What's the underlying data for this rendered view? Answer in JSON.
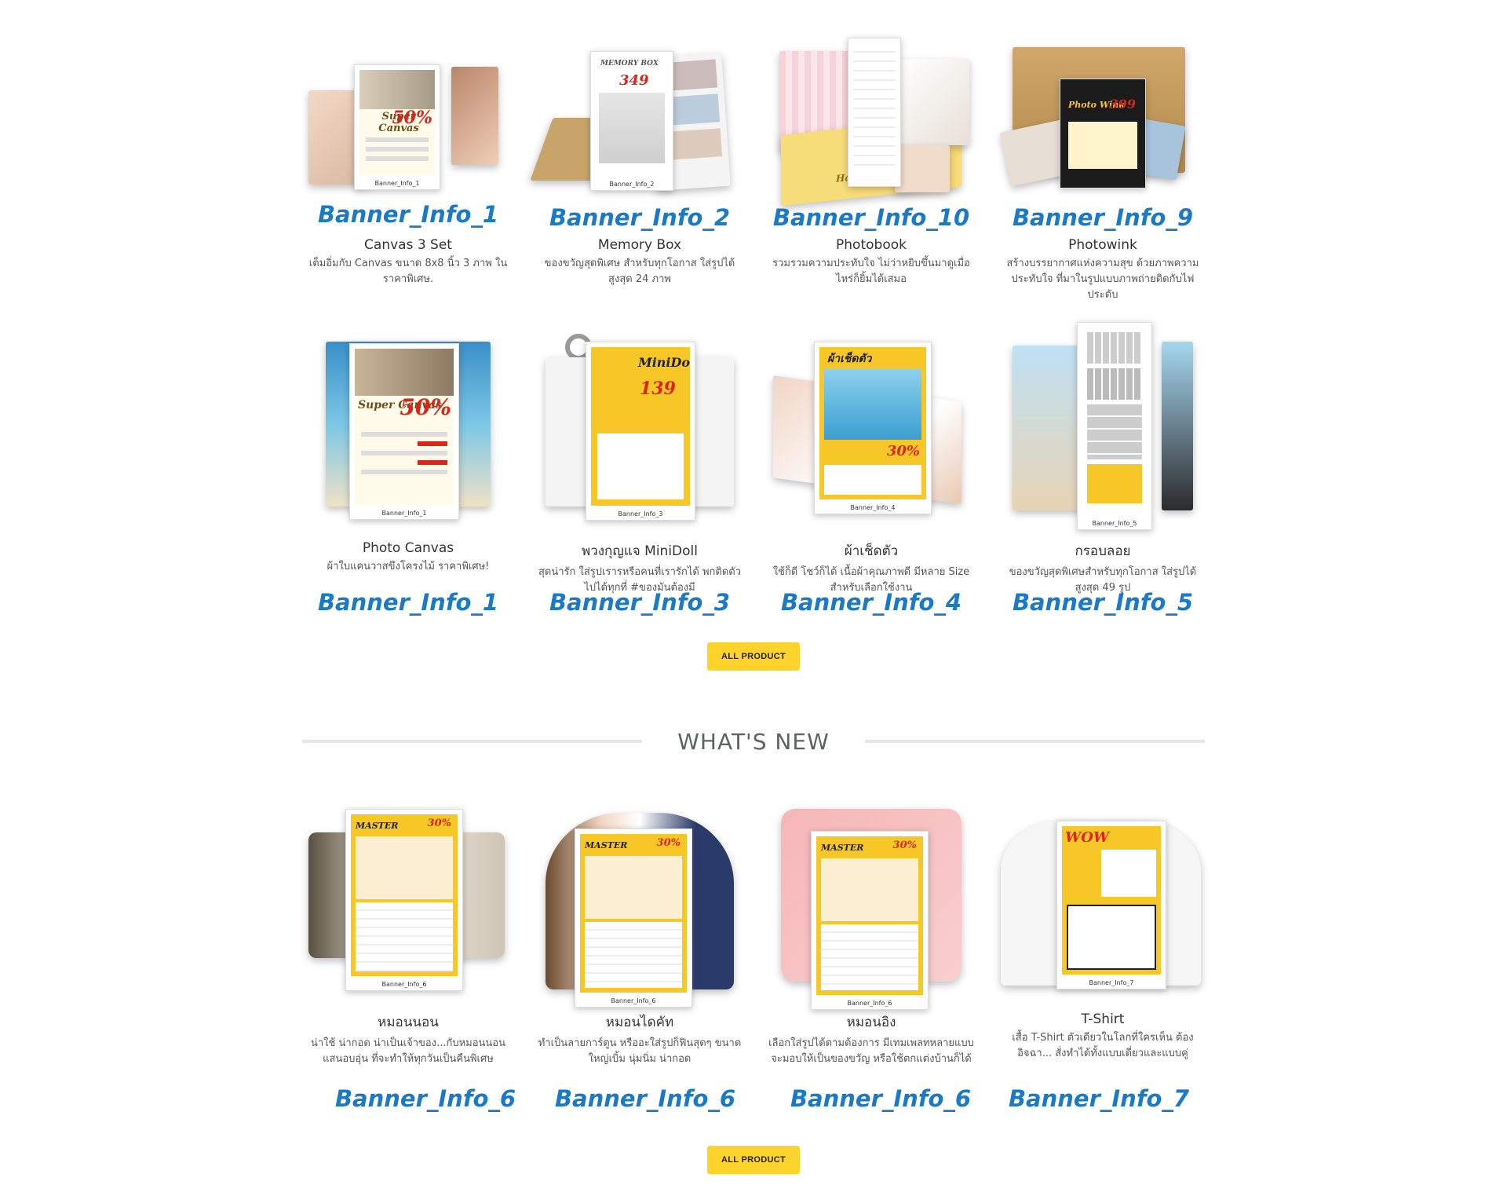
{
  "section1": {
    "cards": [
      {
        "title": "Canvas 3 Set",
        "desc": "เต็มอิ่มกับ Canvas ขนาด 8x8 นิ้ว 3 ภาพ ในราคาพิเศษ.",
        "banner": "Banner_Info_1",
        "caption": "Banner_Info_1",
        "flyer_text": "Super Canvas",
        "flyer_num": "50%"
      },
      {
        "title": "Memory Box",
        "desc": "ของขวัญสุดพิเศษ สำหรับทุกโอกาส ใส่รูปได้สูงสุด 24 ภาพ",
        "banner": "Banner_Info_2",
        "caption": "Banner_Info_2",
        "flyer_text": "MEMORY BOX",
        "flyer_num": "349"
      },
      {
        "title": "Photobook",
        "desc": "รวมรวมความประทับใจ ไม่ว่าหยิบขึ้นมาดูเมื่อไหร่ก็ยิ้มได้เสมอ",
        "banner": "Banner_Info_10",
        "caption": "",
        "flyer_text": "Happy Time",
        "flyer_num": ""
      },
      {
        "title": "Photowink",
        "desc": "สร้างบรรยากาศแห่งความสุข ด้วยภาพความประทับใจ ที่มาในรูปแบบภาพถ่ายติดกับไฟประดับ",
        "banner": "Banner_Info_9",
        "caption": "",
        "flyer_text": "Photo Wink",
        "flyer_num": "399"
      },
      {
        "title": "Photo Canvas",
        "desc": "ผ้าใบแคนวาสขึงโครงไม้ ราคาพิเศษ!",
        "banner": "Banner_Info_1",
        "caption": "Banner_Info_1",
        "flyer_text": "Super Canvas",
        "flyer_num": "50%"
      },
      {
        "title": "พวงกุญแจ MiniDoll",
        "desc": "สุดน่ารัก ใส่รูปเรารหรือคนที่เรารักได้ พกติดตัวไปได้ทุกที่ #ของมันต้องมี",
        "banner": "Banner_Info_3",
        "caption": "Banner_Info_3",
        "flyer_text": "MiniDoll",
        "flyer_num": "139"
      },
      {
        "title": "ผ้าเช็ดตัว",
        "desc": "ใช้ก็ดี โชว์ก็ได้ เนื้อผ้าคุณภาพดี มีหลาย Size สำหรับเลือกใช้งาน",
        "banner": "Banner_Info_4",
        "caption": "Banner_Info_4",
        "flyer_text": "ผ้าเช็ดตัว",
        "flyer_num": "30%"
      },
      {
        "title": "กรอบลอย",
        "desc": "ของขวัญสุดพิเศษสำหรับทุกโอกาส ใส่รูปได้สูงสุด 49 รูป",
        "banner": "Banner_Info_5",
        "caption": "Banner_Info_5",
        "flyer_text": "",
        "flyer_num": ""
      }
    ],
    "button_label": "ALL PRODUCT"
  },
  "section2": {
    "heading": "WHAT'S NEW",
    "cards": [
      {
        "title": "หมอนนอน",
        "desc": "น่าใช้ น่ากอด น่าเป็นเจ้าของ...กับหมอนนอนแสนอบอุ่น ที่จะทำให้ทุกวันเป็นคืนพิเศษ",
        "banner": "Banner_Info_6",
        "caption": "Banner_Info_6",
        "flyer_text": "MASTER",
        "flyer_num": "30%"
      },
      {
        "title": "หมอนไดคัท",
        "desc": "ทำเป็นลายการ์ตูน หรืออะใส่รูปก็ฟินสุดๆ ขนาดใหญ่เบิ้ม นุ่มนิ่ม น่ากอด",
        "banner": "Banner_Info_6",
        "caption": "Banner_Info_6",
        "flyer_text": "MASTER",
        "flyer_num": "30%"
      },
      {
        "title": "หมอนอิง",
        "desc": "เลือกใส่รูปได้ตามต้องการ มีเทมเพลทหลายแบบ จะมอบให้เป็นของขวัญ หรือใช้ตกแต่งบ้านก็ได้",
        "banner": "Banner_Info_6",
        "caption": "Banner_Info_6",
        "flyer_text": "MASTER",
        "flyer_num": "30%"
      },
      {
        "title": "T-Shirt",
        "desc": "เสื้อ T-Shirt ตัวเดียวในโลกที่ใครเห็น ต้องอิจฉา... สั่งทำได้ทั้งแบบเดี่ยวและแบบคู่",
        "banner": "Banner_Info_7",
        "caption": "Banner_Info_7",
        "flyer_text": "WOW",
        "flyer_num": ""
      }
    ],
    "button_label": "ALL PRODUCT"
  },
  "colors": {
    "accent": "#fed32b",
    "banner_blue": "#1a7ac6",
    "flyer_yellow": "#f7c627"
  }
}
